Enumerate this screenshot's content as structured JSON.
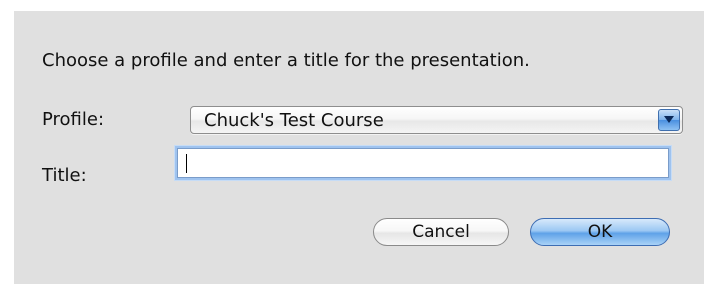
{
  "dialog": {
    "prompt": "Choose a profile and enter a title for the presentation.",
    "profile_label": "Profile:",
    "profile_value": "Chuck's Test Course",
    "title_label": "Title:",
    "title_value": "",
    "cancel_label": "Cancel",
    "ok_label": "OK"
  },
  "icons": {
    "popup_arrow": "chevron-down-icon"
  },
  "colors": {
    "dialog_background": "#e0e0e0",
    "default_button": "#5fa2e8",
    "focus_ring": "#9fc3ef"
  }
}
